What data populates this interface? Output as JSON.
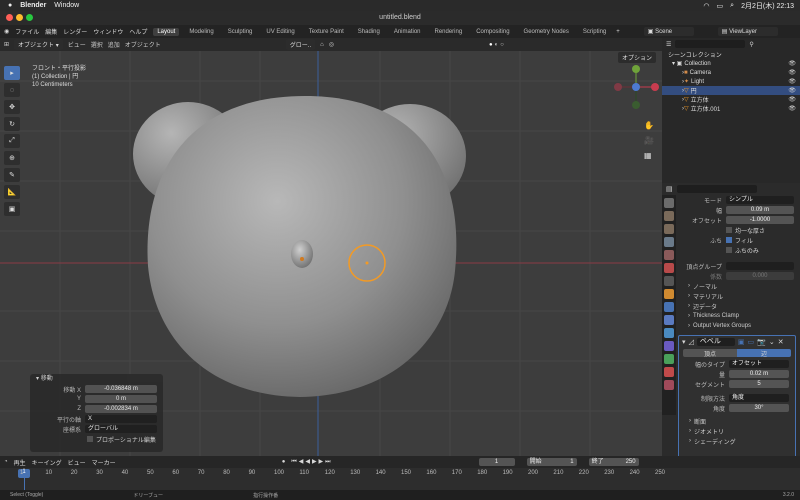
{
  "macbar": {
    "app": "Blender",
    "menu": "Window",
    "datetime": "2月2日(木) 22:13"
  },
  "titlebar": {
    "title": "untitled.blend"
  },
  "topbar": {
    "menus": [
      "ファイル",
      "編集",
      "レンダー",
      "ウィンドウ",
      "ヘルプ"
    ],
    "workspaces": [
      "Layout",
      "Modeling",
      "Sculpting",
      "UV Editing",
      "Texture Paint",
      "Shading",
      "Animation",
      "Rendering",
      "Compositing",
      "Geometry Nodes",
      "Scripting"
    ],
    "scene": "Scene",
    "viewlayer": "ViewLayer"
  },
  "vphead": {
    "mode": "オブジェクト",
    "menus": [
      "ビュー",
      "選択",
      "追加",
      "オブジェクト"
    ],
    "transform": "グロー..",
    "options": "オプション"
  },
  "viewport": {
    "info_line1": "フロント・平行投影",
    "info_line2": "(1) Collection | 円",
    "info_line3": "10 Centimeters"
  },
  "outliner": {
    "title": "シーンコレクション",
    "items": [
      {
        "label": "Collection",
        "level": 0
      },
      {
        "label": "Camera",
        "level": 1
      },
      {
        "label": "Light",
        "level": 1
      },
      {
        "label": "円",
        "level": 1,
        "selected": true
      },
      {
        "label": "立方体",
        "level": 1
      },
      {
        "label": "立方体.001",
        "level": 1
      }
    ]
  },
  "props": {
    "mode_label": "モード",
    "mode_value": "シンプル",
    "width_label": "幅",
    "width_value": "0.09 m",
    "offset_label": "オフセット",
    "offset_value": "-1.0000",
    "even_label": "均一な厚さ",
    "rim_label": "ふち",
    "fill_label": "フィル",
    "rim_only_label": "ふちのみ",
    "vgroup_label": "頂点グループ",
    "factor_label": "係数",
    "factor_value": "0.000",
    "sections": [
      "ノーマル",
      "マテリアル",
      "辺データ",
      "Thickness Clamp",
      "Output Vertex Groups"
    ],
    "bevel_name": "ベベル",
    "tab_vertex": "頂点",
    "tab_edge": "辺",
    "width_type_label": "幅のタイプ",
    "width_type_value": "オフセット",
    "amount_label": "量",
    "amount_value": "0.02 m",
    "segments_label": "セグメント",
    "segments_value": "5",
    "limit_label": "制限方法",
    "limit_value": "角度",
    "angle_label": "角度",
    "angle_value": "30°",
    "sub_sections": [
      "断面",
      "ジオメトリ",
      "シェーディング"
    ]
  },
  "oppanel": {
    "title": "移動",
    "move_label": "移動 X",
    "move_x": "-0.036848 m",
    "y_label": "Y",
    "move_y": "0 m",
    "z_label": "Z",
    "move_z": "-0.002834 m",
    "orient_axis_label": "平行の軸",
    "orient_axis": "X",
    "orient_label": "座標系",
    "orient": "グローバル",
    "proportional": "プロポーショナル編集"
  },
  "timeline": {
    "menus": [
      "再生",
      "キーイング",
      "ビュー",
      "マーカー"
    ],
    "current": "1",
    "start_label": "開始",
    "start": "1",
    "end_label": "終了",
    "end": "250",
    "ticks": [
      "1",
      "10",
      "20",
      "30",
      "40",
      "50",
      "60",
      "70",
      "80",
      "90",
      "100",
      "110",
      "120",
      "130",
      "140",
      "150",
      "160",
      "170",
      "180",
      "190",
      "200",
      "210",
      "220",
      "230",
      "240",
      "250"
    ]
  },
  "statusbar": {
    "select": "Select (Toggle)",
    "pan": "ドリーブュー",
    "menu": "指行操作番",
    "version": "3.2.0"
  }
}
